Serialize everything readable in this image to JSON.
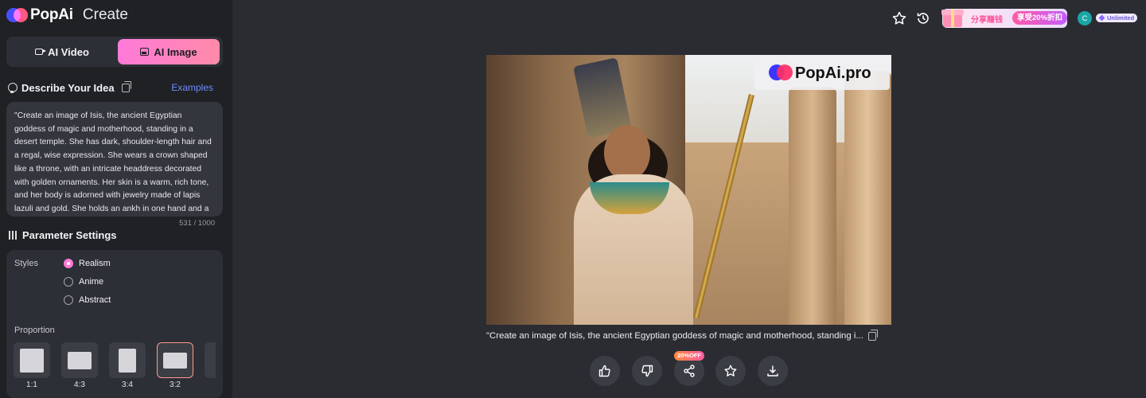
{
  "brand": {
    "name": "PopAi",
    "section": "Create"
  },
  "modes": {
    "video": "AI Video",
    "image": "AI Image"
  },
  "describe": {
    "heading": "Describe Your Idea",
    "examples_label": "Examples",
    "prompt": "\"Create an image of Isis, the ancient Egyptian goddess of magic and motherhood, standing in a desert temple. She has dark, shoulder-length hair and a regal, wise expression. She wears a crown shaped like a throne, with an intricate headdress decorated with golden ornaments. Her skin is a warm, rich tone, and her body is adorned with jewelry made of lapis lazuli and gold. She holds an ankh in one hand and a",
    "count": "531 / 1000"
  },
  "params": {
    "heading": "Parameter Settings",
    "styles_label": "Styles",
    "styles": [
      "Realism",
      "Anime",
      "Abstract"
    ],
    "selected_style": "Realism",
    "proportion_label": "Proportion",
    "ratios": [
      "1:1",
      "4:3",
      "3:4",
      "3:2"
    ],
    "selected_ratio": "3:2"
  },
  "header": {
    "promo_text": "分享赚钱",
    "promo_badge": "享受20%折扣",
    "avatar_initial": "C",
    "plan": "Unlimited"
  },
  "result": {
    "watermark": "PopAi.pro",
    "caption": "\"Create an image of Isis, the ancient Egyptian goddess of magic and motherhood, standing i...",
    "discount_badge": "20%OFF"
  },
  "colors": {
    "accent_pink": "#ff7ad9",
    "link_blue": "#6e8cff",
    "sidebar_bg": "#1f2125",
    "main_bg": "#2a2c32"
  }
}
